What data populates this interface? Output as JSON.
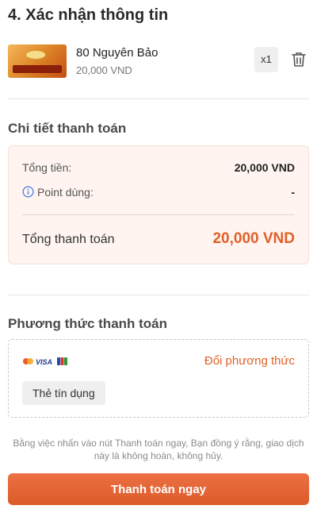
{
  "confirm": {
    "title": "4. Xác nhận thông tin"
  },
  "product": {
    "name": "80 Nguyên Bảo",
    "price": "20,000 VND",
    "quantity": "x1",
    "thumbnail_icon": "gold-ingot-thumbnail",
    "delete_icon": "trash-icon"
  },
  "payment_details": {
    "title": "Chi tiết thanh toán",
    "subtotal_label": "Tổng tiền:",
    "subtotal_value": "20,000 VND",
    "points_label": "Point dùng:",
    "points_value": "-",
    "total_label": "Tổng thanh toán",
    "total_value": "20,000 VND"
  },
  "payment_method": {
    "title": "Phương thức thanh toán",
    "change_label": "Đổi phương thức",
    "selected": "Thẻ tín dụng",
    "card_brand_text": "VISA",
    "card_icons": [
      "mastercard-icon",
      "visa-icon",
      "jcb-icon"
    ]
  },
  "disclaimer": "Bằng việc nhấn vào nút Thanh toán ngay, Bạn đồng ý rằng, giao dịch này là không hoàn, không hủy.",
  "actions": {
    "pay_now_label": "Thanh toán ngay"
  },
  "colors": {
    "accent": "#E0602A",
    "summary_bg": "#FFF4EF"
  }
}
